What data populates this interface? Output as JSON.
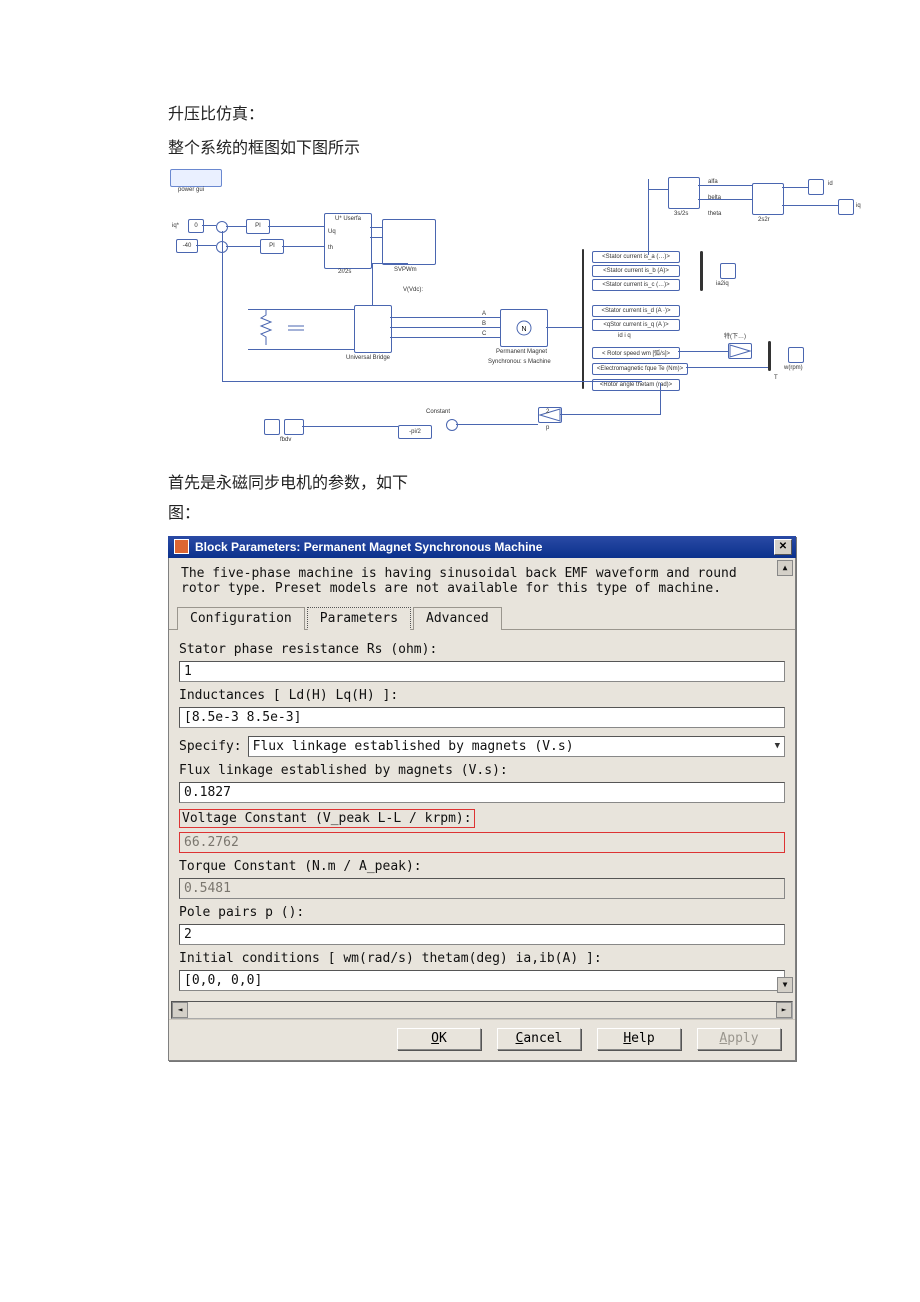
{
  "doc": {
    "line1": "升压比仿真：",
    "line2": "整个系统的框图如下图所示",
    "line3": "首先是永磁同步电机的参数，如下",
    "line4": "图："
  },
  "sim": {
    "powergui": "power gui",
    "iq_star": "iq*",
    "zero": "0",
    "neg40": "-40",
    "pi1": "PI",
    "pi2": "PI",
    "userfa": "U* Userfa",
    "uq": "Uq",
    "th": "th",
    "two_by_2s": "2r/2s",
    "svpwm": "SVPWm",
    "vdc_label": "V(Vdc):",
    "ubridge": "Universal Bridge",
    "pmsm_top": "Permanent Magnet",
    "pmsm_bot": "Synchronou: s Machine",
    "constant": "Constant",
    "neg_pi2": "-pi/2",
    "fbdv": "fbdv",
    "bus_ia": "<Stator current is_a (…)>",
    "bus_ib": "<Stator current is_b (A)>",
    "bus_ic": "<Stator current is_c (…)>",
    "bus_id": "<Stator current is_d (A ·)>",
    "bus_iq": "<qStor current is_q (A )>",
    "bus_wm": "< Rotor speed wm  [弧/s]>",
    "bus_te": "<Electromagnetic fque Te (Nm)>",
    "bus_th": "<Rotor angle thetam (rad)>",
    "idiq": "id i q",
    "ia2iq": "ia2iq",
    "three2two": "3s/2s",
    "two_s_two_r": "2s2r",
    "out_alfa": "alfa",
    "out_belta": "belta",
    "out_theta": "theta",
    "scope_id": "id",
    "scope_iq": "iq",
    "gain_label": "特(下…)",
    "wrpm": "w(rpm)",
    "T": "T",
    "p": "p",
    "gain2": "2"
  },
  "dialog": {
    "title": "Block Parameters: Permanent Magnet Synchronous Machine",
    "close_glyph": "✕",
    "desc_l1": "The five-phase machine is having sinusoidal back EMF waveform and round",
    "desc_l2": "rotor type. Preset models are not available for this type of machine.",
    "tabs": {
      "config": "Configuration",
      "params": "Parameters",
      "adv": "Advanced"
    },
    "fields": {
      "rs_label": "Stator phase resistance Rs (ohm):",
      "rs_value": "1",
      "l_label": "Inductances [ Ld(H) Lq(H) ]:",
      "l_value": "[8.5e-3 8.5e-3]",
      "specify_label": "Specify:",
      "specify_value": "Flux linkage established by magnets (V.s)",
      "flux_label": "Flux linkage established by magnets (V.s):",
      "flux_value": "0.1827",
      "vconst_label": "Voltage Constant (V_peak L-L / krpm):",
      "vconst_value": "66.2762",
      "tconst_label": "Torque Constant (N.m / A_peak):",
      "tconst_value": "0.5481",
      "poles_label": "Pole pairs p ():",
      "poles_value": "2",
      "init_label": "Initial conditions  [ wm(rad/s)  thetam(deg)  ia,ib(A) ]:",
      "init_value": "[0,0, 0,0]"
    },
    "buttons": {
      "ok": "OK",
      "ok_ul": "O",
      "cancel": "Cancel",
      "cancel_ul": "C",
      "help": "Help",
      "help_ul": "H",
      "apply": "Apply",
      "apply_ul": "A"
    }
  }
}
